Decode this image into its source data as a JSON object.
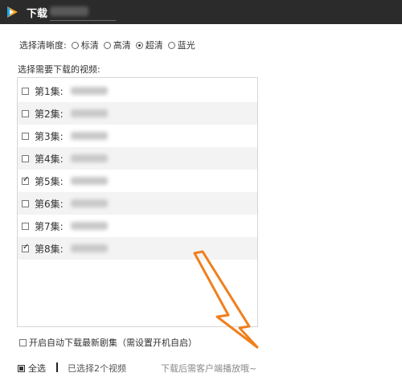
{
  "window": {
    "title": "下载",
    "icon": "tencent-video-logo"
  },
  "quality": {
    "label": "选择清晰度:",
    "options": [
      {
        "label": "标清",
        "selected": false
      },
      {
        "label": "高清",
        "selected": false
      },
      {
        "label": "超清",
        "selected": true
      },
      {
        "label": "蓝光",
        "selected": false
      }
    ]
  },
  "episodes": {
    "label": "选择需要下载的视频:",
    "items": [
      {
        "label": "第1集:",
        "checked": false
      },
      {
        "label": "第2集:",
        "checked": false
      },
      {
        "label": "第3集:",
        "checked": false
      },
      {
        "label": "第4集:",
        "checked": false
      },
      {
        "label": "第5集:",
        "checked": true
      },
      {
        "label": "第6集:",
        "checked": false
      },
      {
        "label": "第7集:",
        "checked": false
      },
      {
        "label": "第8集:",
        "checked": true
      }
    ]
  },
  "auto_download": {
    "label": "开启自动下载最新剧集（需设置开机自启）",
    "checked": false
  },
  "footer": {
    "select_all": "全选",
    "selected_count": "已选择2个视频",
    "hint": "下载后需客户端播放哦~"
  },
  "colors": {
    "titlebar": "#2b2b2b",
    "annotation_arrow": "#f07f1e",
    "logo_primary": "#f5a623",
    "logo_secondary": "#1ea6f0"
  }
}
